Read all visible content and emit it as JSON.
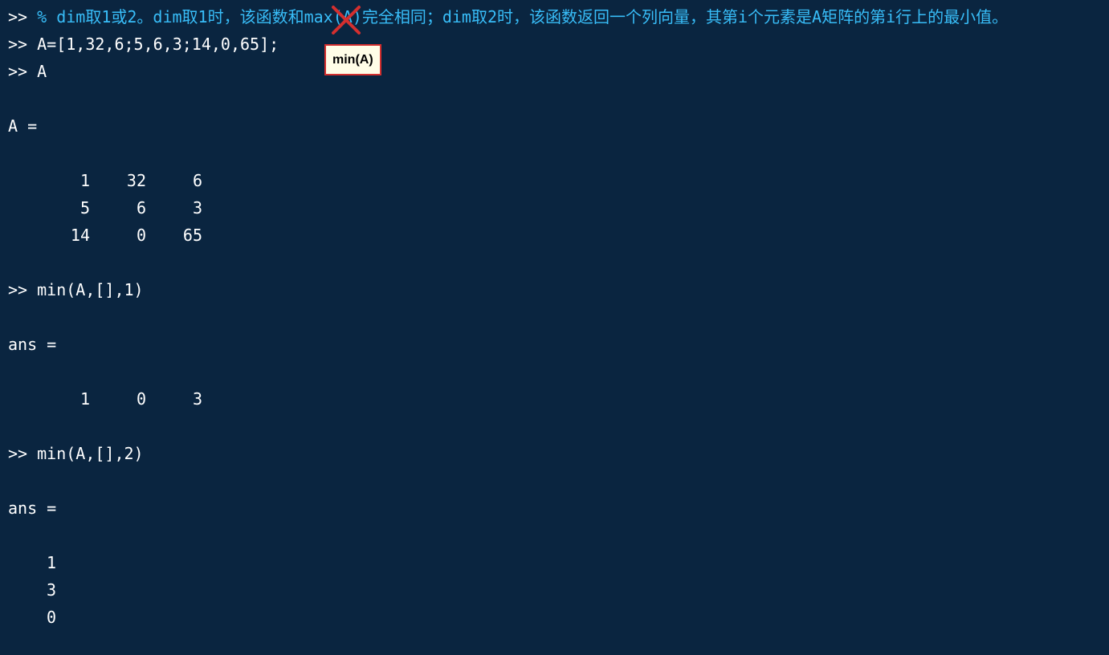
{
  "prompt": ">>",
  "comment_line": "% dim取1或2。dim取1时，该函数和max(A)完全相同；dim取2时，该函数返回一个列向量，其第i个元素是A矩阵的第i行上的最小值。",
  "cmd_assign": "A=[1,32,6;5,6,3;14,0,65];",
  "cmd_showA": "A",
  "labelA": "A =",
  "matrixA": {
    "r0": {
      "c0": "1",
      "c1": "32",
      "c2": "6"
    },
    "r1": {
      "c0": "5",
      "c1": "6",
      "c2": "3"
    },
    "r2": {
      "c0": "14",
      "c1": "0",
      "c2": "65"
    }
  },
  "cmd_min1": "min(A,[],1)",
  "ans_label": "ans =",
  "ans1": {
    "c0": "1",
    "c1": "0",
    "c2": "3"
  },
  "cmd_min2": "min(A,[],2)",
  "ans2": {
    "r0": "1",
    "r1": "3",
    "r2": "0"
  },
  "tooltip": "min(A)"
}
